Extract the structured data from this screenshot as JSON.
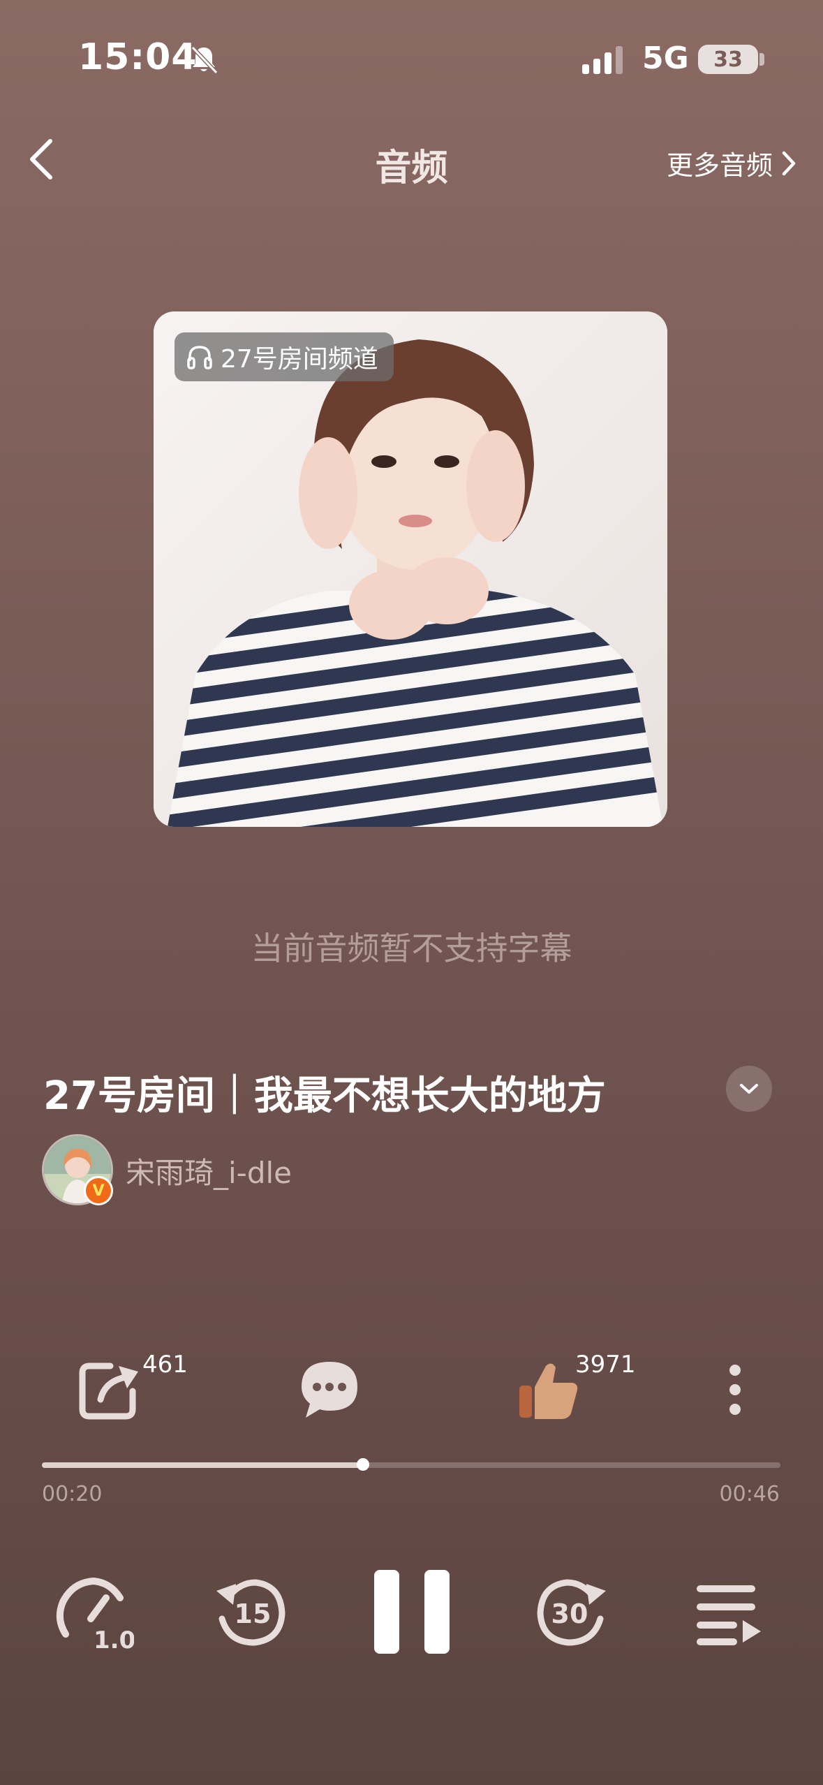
{
  "status_bar": {
    "time": "15:04",
    "network": "5G",
    "battery": "33"
  },
  "header": {
    "title": "音频",
    "more_label": "更多音频"
  },
  "cover": {
    "channel_tag": "27号房间频道"
  },
  "subtitle_note": "当前音频暂不支持字幕",
  "track": {
    "title": "27号房间｜我最不想长大的地方",
    "author": "宋雨琦_i-dle",
    "verified_mark": "V"
  },
  "actions": {
    "share_count": "461",
    "like_count": "3971"
  },
  "player": {
    "elapsed": "00:20",
    "duration": "00:46",
    "progress": 0.435,
    "speed": "1.0x",
    "rewind_seconds": "15",
    "forward_seconds": "30"
  },
  "colors": {
    "accent_like": "#d8a27c",
    "background_top": "#8b6a64",
    "background_bottom": "#5b443f"
  }
}
